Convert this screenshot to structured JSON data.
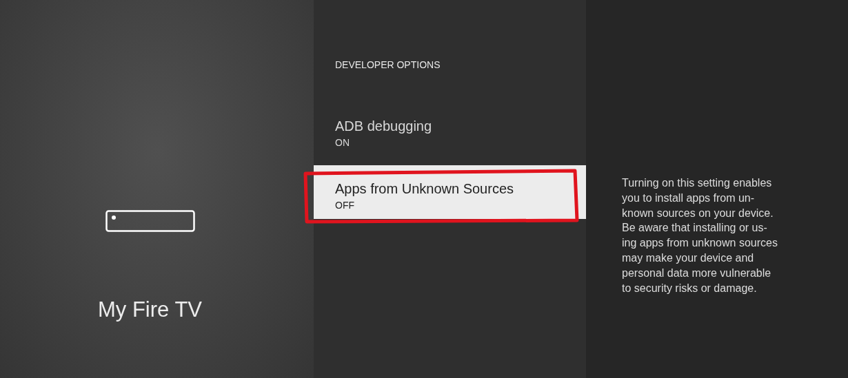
{
  "sidebar": {
    "title": "My Fire TV"
  },
  "section": {
    "heading": "DEVELOPER OPTIONS"
  },
  "settings": [
    {
      "label": "ADB debugging",
      "value": "ON",
      "selected": false,
      "annotated": false
    },
    {
      "label": "Apps from Unknown Sources",
      "value": "OFF",
      "selected": true,
      "annotated": true
    }
  ],
  "description_lines": [
    "Turning on this setting enables",
    "you to install apps from un-",
    "known sources on your device.",
    "Be aware that installing or us-",
    "ing apps from unknown sources",
    "may make your device and",
    "personal data more vulnerable",
    "to security risks or damage."
  ]
}
